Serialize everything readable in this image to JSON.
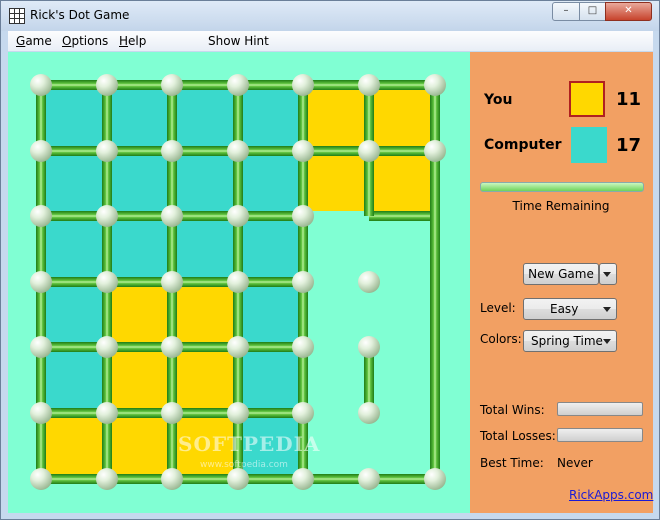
{
  "window": {
    "title": "Rick's Dot Game",
    "min_glyph": "–",
    "max_glyph": "□",
    "close_glyph": "✕"
  },
  "menu": {
    "game": {
      "key": "G",
      "rest": "ame"
    },
    "options": {
      "key": "O",
      "rest": "ptions"
    },
    "help": {
      "key": "H",
      "rest": "elp"
    },
    "hint": "Show Hint"
  },
  "board": {
    "cols": 7,
    "rows": 6,
    "colors": {
      "board": "#80ffd3",
      "computer": "#3ad9cc",
      "you": "#ffd800"
    },
    "squares": [
      [
        "c",
        "c",
        "c",
        "c",
        "y",
        "y",
        ""
      ],
      [
        "c",
        "c",
        "c",
        "c",
        "y",
        "y",
        ""
      ],
      [
        "c",
        "c",
        "c",
        "c",
        "",
        "",
        ""
      ],
      [
        "c",
        "y",
        "y",
        "c",
        "",
        "",
        ""
      ],
      [
        "c",
        "y",
        "y",
        "c",
        "",
        "",
        ""
      ],
      [
        "y",
        "y",
        "y",
        "c",
        "",
        "",
        ""
      ]
    ],
    "h_lines": [
      [
        1,
        1,
        1,
        1,
        1,
        1
      ],
      [
        1,
        1,
        1,
        1,
        1,
        1
      ],
      [
        1,
        1,
        1,
        1,
        0,
        1
      ],
      [
        1,
        1,
        1,
        1,
        0,
        0
      ],
      [
        1,
        1,
        1,
        1,
        0,
        0
      ],
      [
        1,
        1,
        1,
        1,
        0,
        0
      ],
      [
        1,
        1,
        1,
        1,
        1,
        1
      ]
    ],
    "v_lines": [
      [
        1,
        1,
        1,
        1,
        1,
        1
      ],
      [
        1,
        1,
        1,
        1,
        1,
        1
      ],
      [
        1,
        1,
        1,
        1,
        1,
        1
      ],
      [
        1,
        1,
        1,
        1,
        1,
        1
      ],
      [
        1,
        1,
        1,
        1,
        1,
        1
      ],
      [
        1,
        1,
        0,
        0,
        1,
        0
      ],
      [
        1,
        1,
        1,
        1,
        1,
        1
      ]
    ],
    "dots": [
      [
        1,
        1,
        1,
        1,
        1,
        1,
        1
      ],
      [
        1,
        1,
        1,
        1,
        1,
        1,
        1
      ],
      [
        1,
        1,
        1,
        1,
        1,
        1,
        1
      ],
      [
        1,
        1,
        1,
        1,
        1,
        1,
        1
      ],
      [
        1,
        1,
        1,
        1,
        1,
        1,
        1
      ],
      [
        1,
        1,
        1,
        1,
        1,
        1,
        1
      ],
      [
        1,
        1,
        1,
        1,
        1,
        1,
        1
      ]
    ],
    "dots_missing": [
      [
        5,
        2
      ],
      [
        6,
        2
      ],
      [
        6,
        3
      ],
      [
        6,
        4
      ],
      [
        6,
        5
      ]
    ],
    "watermark": "SOFTPEDIA",
    "watermark_url": "www.softpedia.com"
  },
  "players": {
    "you": {
      "label": "You",
      "score": "11",
      "color": "#ffd800"
    },
    "computer": {
      "label": "Computer",
      "score": "17",
      "color": "#3ad9cc"
    }
  },
  "time": {
    "label": "Time Remaining",
    "progress": 1.0
  },
  "controls": {
    "new_game": "New Game",
    "level_label": "Level:",
    "level_value": "Easy",
    "colors_label": "Colors:",
    "colors_value": "Spring Time"
  },
  "stats": {
    "wins_label": "Total Wins:",
    "losses_label": "Total Losses:",
    "best_label": "Best Time:",
    "best_value": "Never"
  },
  "link": "RickApps.com"
}
